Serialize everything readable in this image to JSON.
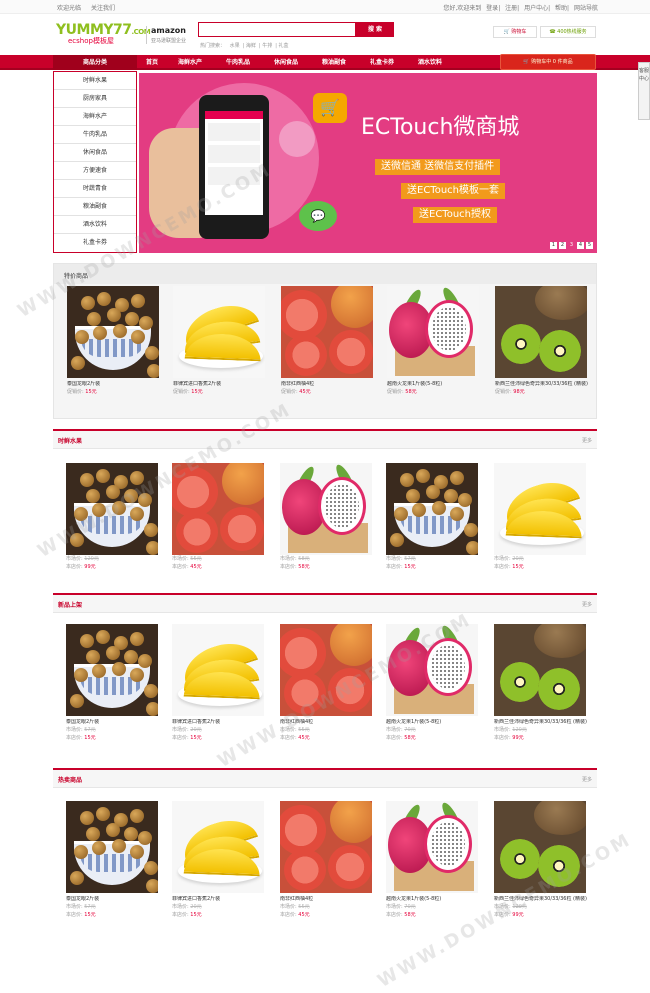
{
  "topbar": {
    "left": [
      "欢迎光临",
      "关注我们"
    ],
    "right": [
      "您好,欢迎来到",
      "登录",
      "注册",
      "用户中心",
      "帮助",
      "网站导航"
    ]
  },
  "header": {
    "logo_main": "YUMMY77",
    "logo_com": ".COM",
    "logo_sub": "ecshop模板屋",
    "amazon_brand": "amazon",
    "amazon_sub": "亚马逊联盟企业",
    "search_btn": "搜 索",
    "hot_words": [
      "热门搜索：",
      "水果",
      "海鲜",
      "牛排",
      "礼盒"
    ],
    "cart_label": "购物车",
    "service_label": "400热线服务"
  },
  "nav": {
    "category_title": "商品分类",
    "items": [
      "首页",
      "海鲜水产",
      "牛肉乳品",
      "休闲食品",
      "粮油副食",
      "礼盒卡券",
      "酒水饮料"
    ],
    "cart": "购物车中 0 件商品"
  },
  "sidebar": [
    "时鲜水果",
    "厨房家具",
    "海鲜水产",
    "牛肉乳品",
    "休闲食品",
    "方便速食",
    "时蔬青食",
    "粮油副食",
    "酒水饮料",
    "礼盒卡券"
  ],
  "banner": {
    "title": "ECTouch微商城",
    "tags": [
      "送微信通 送微信支付插件",
      "送ECTouch模板一套",
      "送ECTouch授权"
    ],
    "slides": [
      "1",
      "2",
      "3",
      "4",
      "5"
    ],
    "active_slide": 2
  },
  "side_tab": "客服中心",
  "sections": {
    "tejia": {
      "title": "特价商品",
      "products": [
        {
          "name": "泰国龙眼2斤装",
          "price_label": "促销价:",
          "price": "15元",
          "img": "longan"
        },
        {
          "name": "菲律宾进口香蕉2斤装",
          "price_label": "促销价:",
          "price": "15元",
          "img": "banana"
        },
        {
          "name": "南非红西柚4粒",
          "price_label": "促销价:",
          "price": "45元",
          "img": "grapefruit"
        },
        {
          "name": "越南火龙果1斤装(5-8粒)",
          "price_label": "促销价:",
          "price": "58元",
          "img": "dragon"
        },
        {
          "name": "新西兰佳沛绿色奇异果30/33/36粒 (精装)",
          "price_label": "促销价:",
          "price": "98元",
          "img": "kiwi"
        }
      ]
    },
    "shixian": {
      "title": "时鲜水果",
      "more": "更多",
      "products": [
        {
          "name": "",
          "market_label": "市场价:",
          "market": "120元",
          "shop_label": "本店价:",
          "shop": "99元",
          "img": "longan"
        },
        {
          "name": "",
          "market_label": "市场价:",
          "market": "55元",
          "shop_label": "本店价:",
          "shop": "45元",
          "img": "grapefruit"
        },
        {
          "name": "",
          "market_label": "市场价:",
          "market": "58元",
          "shop_label": "本店价:",
          "shop": "58元",
          "img": "dragon"
        },
        {
          "name": "",
          "market_label": "市场价:",
          "market": "57元",
          "shop_label": "本店价:",
          "shop": "15元",
          "img": "longan"
        },
        {
          "name": "",
          "market_label": "市场价:",
          "market": "20元",
          "shop_label": "本店价:",
          "shop": "15元",
          "img": "banana"
        }
      ]
    },
    "xinpin": {
      "title": "新品上架",
      "more": "更多",
      "products": [
        {
          "name": "泰国龙眼2斤装",
          "market_label": "市场价:",
          "market": "57元",
          "shop_label": "本店价:",
          "shop": "15元",
          "img": "longan"
        },
        {
          "name": "菲律宾进口香蕉2斤装",
          "market_label": "市场价:",
          "market": "20元",
          "shop_label": "本店价:",
          "shop": "15元",
          "img": "banana"
        },
        {
          "name": "南非红西柚4粒",
          "market_label": "市场价:",
          "market": "55元",
          "shop_label": "本店价:",
          "shop": "45元",
          "img": "grapefruit"
        },
        {
          "name": "越南火龙果1斤装(5-8粒)",
          "market_label": "市场价:",
          "market": "70元",
          "shop_label": "本店价:",
          "shop": "58元",
          "img": "dragon"
        },
        {
          "name": "新西兰佳沛绿色奇异果30/33/36粒 (精装)",
          "market_label": "市场价:",
          "market": "120元",
          "shop_label": "本店价:",
          "shop": "99元",
          "img": "kiwi"
        }
      ]
    },
    "rexiao": {
      "title": "热卖商品",
      "more": "更多",
      "products": [
        {
          "name": "泰国龙眼2斤装",
          "market_label": "市场价:",
          "market": "57元",
          "shop_label": "本店价:",
          "shop": "15元",
          "img": "longan"
        },
        {
          "name": "菲律宾进口香蕉2斤装",
          "market_label": "市场价:",
          "market": "20元",
          "shop_label": "本店价:",
          "shop": "15元",
          "img": "banana"
        },
        {
          "name": "南非红西柚4粒",
          "market_label": "市场价:",
          "market": "55元",
          "shop_label": "本店价:",
          "shop": "45元",
          "img": "grapefruit"
        },
        {
          "name": "越南火龙果1斤装(5-8粒)",
          "market_label": "市场价:",
          "market": "70元",
          "shop_label": "本店价:",
          "shop": "58元",
          "img": "dragon"
        },
        {
          "name": "新西兰佳沛绿色奇异果30/33/36粒 (精装)",
          "market_label": "市场价:",
          "market": "120元",
          "shop_label": "本店价:",
          "shop": "99元",
          "img": "kiwi"
        }
      ]
    }
  },
  "watermark": "WWW.DOWNCEMO.COM",
  "colors": {
    "brand_red": "#c8002a",
    "banner_pink": "#e33c82",
    "tag_orange": "#f29a1c",
    "price_red": "#e5003a"
  }
}
